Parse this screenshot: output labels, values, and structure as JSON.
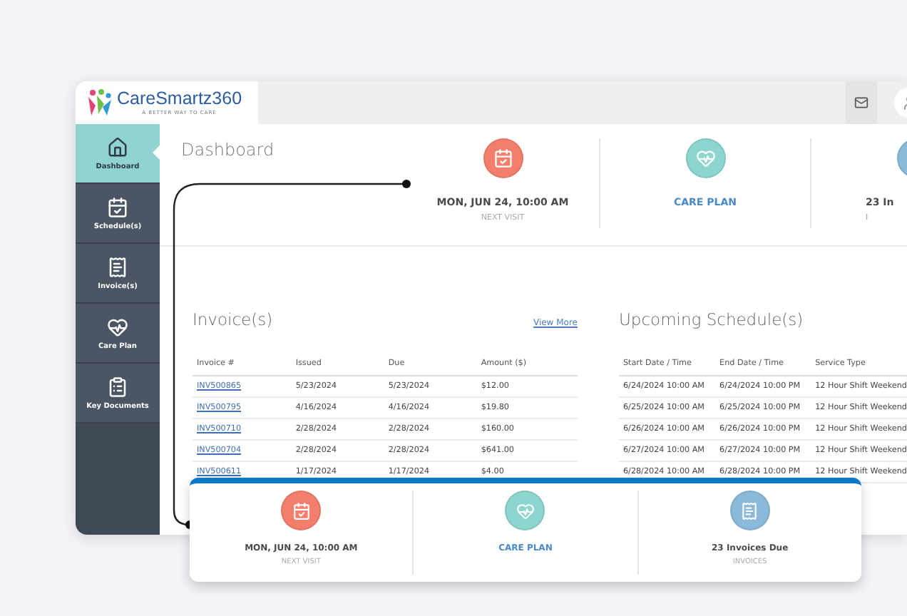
{
  "logo": {
    "name": "CareSmartz360",
    "tagline": "A BETTER WAY TO CARE"
  },
  "sidebar": {
    "items": [
      {
        "label": "Dashboard",
        "kind": "home",
        "selected": true
      },
      {
        "label": "Schedule(s)",
        "kind": "schedule",
        "selected": false
      },
      {
        "label": "Invoice(s)",
        "kind": "invoice",
        "selected": false
      },
      {
        "label": "Care Plan",
        "kind": "careplan",
        "selected": false
      },
      {
        "label": "Key Documents",
        "kind": "documents",
        "selected": false
      }
    ]
  },
  "page_title": "Dashboard",
  "summary_cards": [
    {
      "kind": "visit",
      "color": "#f47e6c",
      "title": "MON, JUN 24, 10:00 AM",
      "subtitle": "NEXT VISIT"
    },
    {
      "kind": "careplan",
      "color": "#8dd5cf",
      "title": "CARE PLAN"
    },
    {
      "kind": "invoices",
      "color": "#8ab9d9",
      "title": "23 In",
      "subtitle": "I"
    }
  ],
  "invoices": {
    "title": "Invoice(s)",
    "link": "View More",
    "columns": [
      "Invoice #",
      "Issued",
      "Due",
      "Amount ($)"
    ],
    "rows": [
      [
        "INV500865",
        "5/23/2024",
        "5/23/2024",
        "$12.00"
      ],
      [
        "INV500795",
        "4/16/2024",
        "4/16/2024",
        "$19.80"
      ],
      [
        "INV500710",
        "2/28/2024",
        "2/28/2024",
        "$160.00"
      ],
      [
        "INV500704",
        "2/28/2024",
        "2/28/2024",
        "$641.00"
      ],
      [
        "INV500611",
        "1/17/2024",
        "1/17/2024",
        "$4.00"
      ]
    ]
  },
  "schedules": {
    "title": "Upcoming Schedule(s)",
    "columns": [
      "Start Date / Time",
      "End Date / Time",
      "Service Type"
    ],
    "rows": [
      [
        "6/24/2024 10:00 AM",
        "6/24/2024 10:00 PM",
        "12 Hour Shift Weekend"
      ],
      [
        "6/25/2024 10:00 AM",
        "6/25/2024 10:00 PM",
        "12 Hour Shift Weekend"
      ],
      [
        "6/26/2024 10:00 AM",
        "6/26/2024 10:00 PM",
        "12 Hour Shift Weekend"
      ],
      [
        "6/27/2024 10:00 AM",
        "6/27/2024 10:00 PM",
        "12 Hour Shift Weekend"
      ],
      [
        "6/28/2024 10:00 AM",
        "6/28/2024 10:00 PM",
        "12 Hour Shift Weekend"
      ]
    ]
  },
  "callout_cards": [
    {
      "kind": "visit",
      "color": "#f47e6c",
      "title": "MON, JUN 24, 10:00 AM",
      "subtitle": "NEXT VISIT"
    },
    {
      "kind": "careplan",
      "color": "#8dd5cf",
      "title": "CARE PLAN"
    },
    {
      "kind": "invoices",
      "color": "#8ab9d9",
      "title": "23 Invoices Due",
      "subtitle": "INVOICES"
    }
  ]
}
